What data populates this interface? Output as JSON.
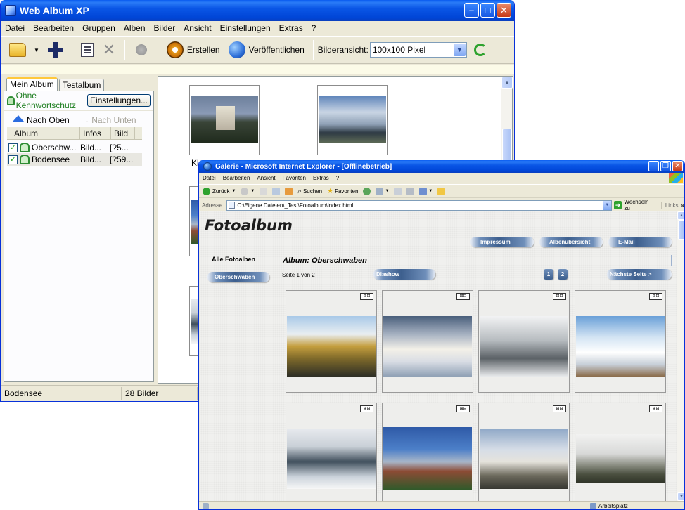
{
  "web_album": {
    "title": "Web Album XP",
    "menu": [
      "Datei",
      "Bearbeiten",
      "Gruppen",
      "Alben",
      "Bilder",
      "Ansicht",
      "Einstellungen",
      "Extras",
      "?"
    ],
    "toolbar": {
      "create_label": "Erstellen",
      "publish_label": "Veröffentlichen",
      "view_label": "Bilderansicht:",
      "view_value": "100x100 Pixel"
    },
    "tabs": [
      "Mein Album",
      "Testalbum"
    ],
    "password_status": "Ohne Kennwortschutz",
    "settings_button": "Einstellungen...",
    "nav_up": "Nach Oben",
    "nav_down": "Nach Unten",
    "columns": [
      "Album",
      "Infos",
      "Bild"
    ],
    "albums": [
      {
        "name": "Oberschw...",
        "infos": "Bild...",
        "bild": "[?5...",
        "checked": true
      },
      {
        "name": "Bodensee",
        "infos": "Bild...",
        "bild": "[?59...",
        "checked": true
      }
    ],
    "status_album": "Bodensee",
    "status_count": "28 Bilder",
    "thumb_caption": "Kl..."
  },
  "ie": {
    "title": "Galerie - Microsoft Internet Explorer - [Offlinebetrieb]",
    "menu": [
      "Datei",
      "Bearbeiten",
      "Ansicht",
      "Favoriten",
      "Extras",
      "?"
    ],
    "toolbar": {
      "back": "Zurück",
      "search": "Suchen",
      "favorites": "Favoriten"
    },
    "address_label": "Adresse",
    "address_value": "C:\\Eigene Dateien\\_Test\\Fotoalbum\\index.html",
    "go_label": "Wechseln zu",
    "links_label": "Links",
    "status_zone": "Arbeitsplatz"
  },
  "page": {
    "site_title": "Fotoalbum",
    "nav": [
      "Impressum",
      "Albenübersicht",
      "E-Mail"
    ],
    "all_albums": "Alle Fotoalben",
    "sidebar_album": "Oberschwaben",
    "album_heading": "Album: Oberschwaben",
    "page_info": "Seite 1 von 2",
    "slideshow": "Diashow",
    "pages": [
      "1",
      "2"
    ],
    "next_page": "Nächste Seite >",
    "zoom_label": "⊞⊟"
  },
  "colors": {
    "xp_blue": "#0a56e6",
    "xp_face": "#ece9d8",
    "pill_blue": "#3d5f8e"
  }
}
